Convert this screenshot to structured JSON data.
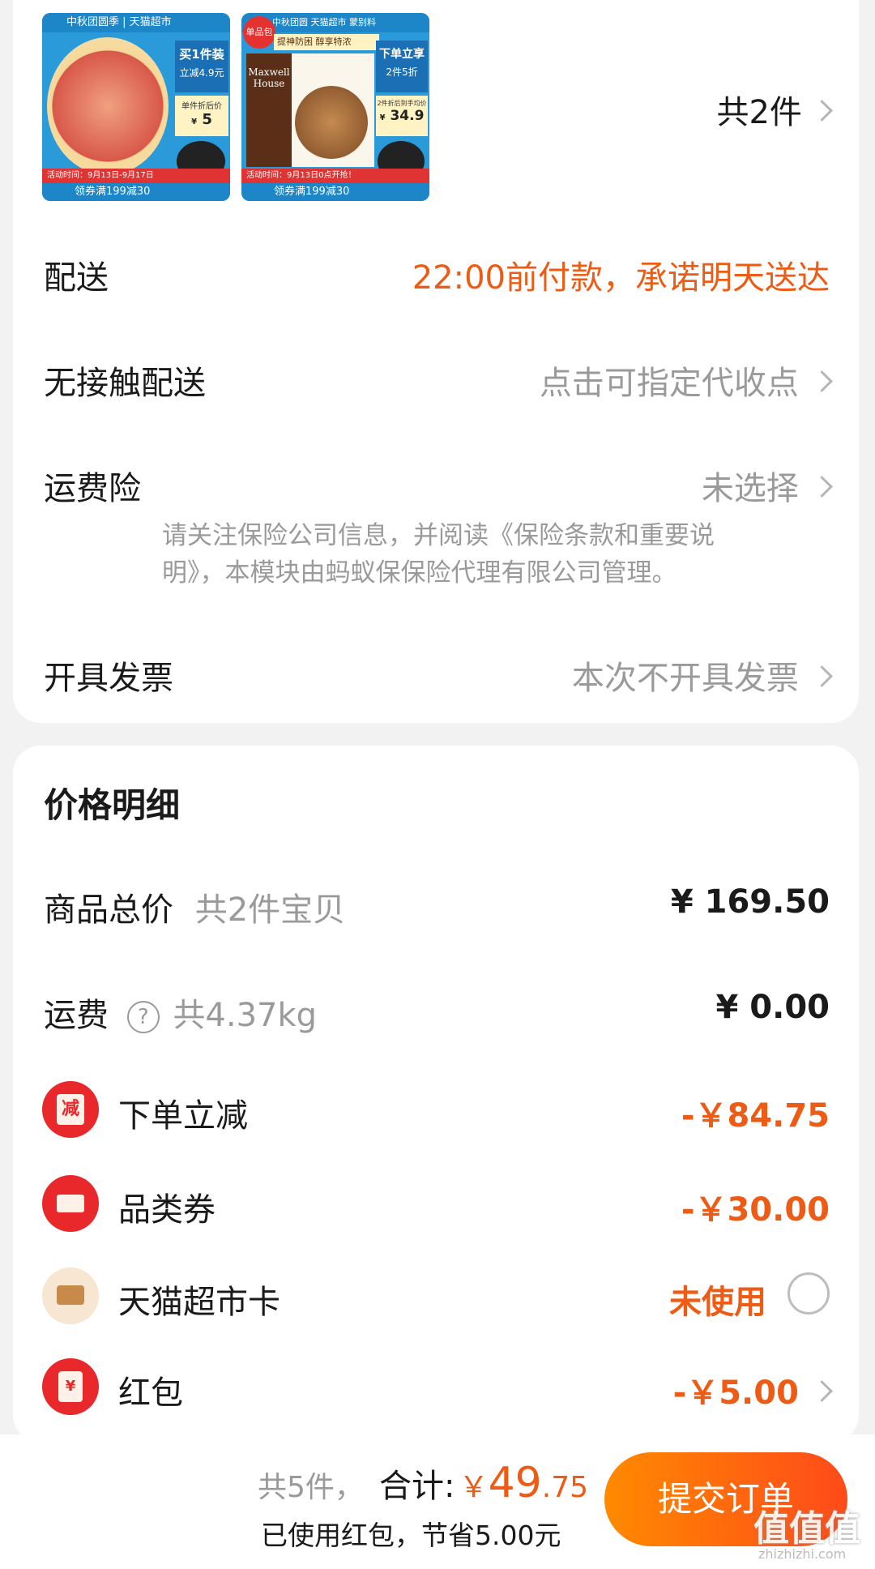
{
  "products": {
    "count_label": "共2件",
    "item1": {
      "header_text": "中秋团圆季 | 天猫超市",
      "promo_title": "买1件装",
      "promo_sub": "立减4.9元",
      "price_label": "单件折后价",
      "price_currency": "¥",
      "price_value": "5",
      "activity_text": "活动时间：9月13日-9月17日",
      "coupon_text": "领券满199减30"
    },
    "item2": {
      "badge_text": "单品包邮",
      "header_text": "中秋团圆 天猫超市 蒙别料",
      "slogan": "提神防困 醇享特浓",
      "brand_line1": "Maxwell",
      "brand_line2": "House",
      "promo_title": "下单立享",
      "promo_sub": "2件5折",
      "price_label": "2件折后到手均价",
      "price_currency": "¥",
      "price_value": "34.9",
      "activity_text": "活动时间：9月13日0点开抢！",
      "coupon_text": "领券满199减30"
    }
  },
  "delivery": {
    "label": "配送",
    "value": "22:00前付款，承诺明天送达"
  },
  "contactless": {
    "label": "无接触配送",
    "value": "点击可指定代收点"
  },
  "insurance": {
    "label": "运费险",
    "value": "未选择",
    "note_line1": "请关注保险公司信息，并阅读《保险条款和重要说",
    "note_line2": "明》，本模块由蚂蚁保保险代理有限公司管理。"
  },
  "invoice": {
    "label": "开具发票",
    "value": "本次不开具发票"
  },
  "price_detail": {
    "title": "价格明细",
    "subtotal": {
      "label": "商品总价",
      "sub": "共2件宝贝",
      "value": "¥ 169.50"
    },
    "shipping": {
      "label": "运费",
      "help_icon": "?",
      "sub": "共4.37kg",
      "value": "¥ 0.00"
    },
    "instant_discount": {
      "icon_text": "减",
      "label": "下单立减",
      "value": "-￥84.75"
    },
    "category_coupon": {
      "label": "品类券",
      "value": "-￥30.00"
    },
    "tmall_card": {
      "label": "天猫超市卡",
      "value": "未使用"
    },
    "red_packet": {
      "icon_text": "¥",
      "label": "红包",
      "value": "-￥5.00"
    }
  },
  "footer": {
    "count": "共5件，",
    "total_label": "合计:",
    "total_currency": "￥",
    "total_int": "49",
    "total_dec": ".75",
    "saving_note": "已使用红包，节省5.00元",
    "submit_label": "提交订单",
    "watermark": "值值值",
    "watermark_url": "zhizhizhi.com"
  },
  "colors": {
    "accent": "#ee5b14",
    "submit_start": "#ff8a00",
    "submit_end": "#ff4a1a",
    "red_icon": "#e8282b"
  }
}
